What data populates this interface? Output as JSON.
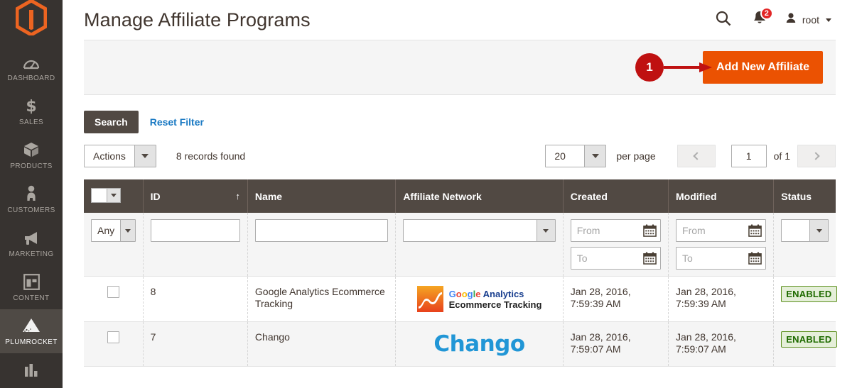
{
  "sidebar": {
    "logo": "magento-logo",
    "items": [
      {
        "label": "DASHBOARD",
        "icon": "dashboard-icon",
        "active": false
      },
      {
        "label": "SALES",
        "icon": "dollar-icon",
        "active": false
      },
      {
        "label": "PRODUCTS",
        "icon": "box-icon",
        "active": false
      },
      {
        "label": "CUSTOMERS",
        "icon": "person-icon",
        "active": false
      },
      {
        "label": "MARKETING",
        "icon": "megaphone-icon",
        "active": false
      },
      {
        "label": "CONTENT",
        "icon": "layout-icon",
        "active": false
      },
      {
        "label": "PLUMROCKET",
        "icon": "plumrocket-icon",
        "active": true
      },
      {
        "label": "",
        "icon": "reports-bar-chart-icon",
        "active": false
      }
    ]
  },
  "header": {
    "title": "Manage Affiliate Programs",
    "search_icon": "search-icon",
    "notifications_icon": "bell-icon",
    "notifications_count": "2",
    "user_icon": "user-avatar-icon",
    "user_name": "root"
  },
  "action_bar": {
    "add_button_label": "Add New Affiliate",
    "annotation_number": "1"
  },
  "filters": {
    "search_label": "Search",
    "reset_label": "Reset Filter"
  },
  "toolbar": {
    "actions_label": "Actions",
    "records_found": "8 records found",
    "per_page_value": "20",
    "per_page_label": "per page",
    "page_value": "1",
    "of_total": "of 1"
  },
  "grid": {
    "columns": [
      {
        "label": "",
        "name": "select-all"
      },
      {
        "label": "ID",
        "name": "id",
        "sorted": "asc",
        "sort_glyph": "↑"
      },
      {
        "label": "Name",
        "name": "name"
      },
      {
        "label": "Affiliate Network",
        "name": "affiliate-network"
      },
      {
        "label": "Created",
        "name": "created"
      },
      {
        "label": "Modified",
        "name": "modified"
      },
      {
        "label": "Status",
        "name": "status"
      }
    ],
    "filter_row": {
      "select_any": "Any",
      "id_value": "",
      "name_value": "",
      "network_value": "",
      "created_from_placeholder": "From",
      "created_to_placeholder": "To",
      "modified_from_placeholder": "From",
      "modified_to_placeholder": "To",
      "status_value": ""
    },
    "rows": [
      {
        "id": "8",
        "name": "Google Analytics Ecommerce Tracking",
        "network_logo": "google-analytics-logo",
        "network_text_1": "Google Analytics",
        "network_text_2": "Ecommerce Tracking",
        "created": "Jan 28, 2016, 7:59:39 AM",
        "modified": "Jan 28, 2016, 7:59:39 AM",
        "status": "ENABLED"
      },
      {
        "id": "7",
        "name": "Chango",
        "network_logo": "chango-logo",
        "network_text_1": "Chango",
        "network_text_2": "",
        "created": "Jan 28, 2016, 7:59:07 AM",
        "modified": "Jan 28, 2016, 7:59:07 AM",
        "status": "ENABLED"
      }
    ]
  },
  "colors": {
    "brand_orange": "#eb5202",
    "sidebar_bg": "#373330",
    "header_row": "#514943",
    "link_blue": "#1979c3",
    "annotation_red": "#bf1111",
    "status_green": "#5b8f1c",
    "chango_blue": "#2196d6"
  }
}
